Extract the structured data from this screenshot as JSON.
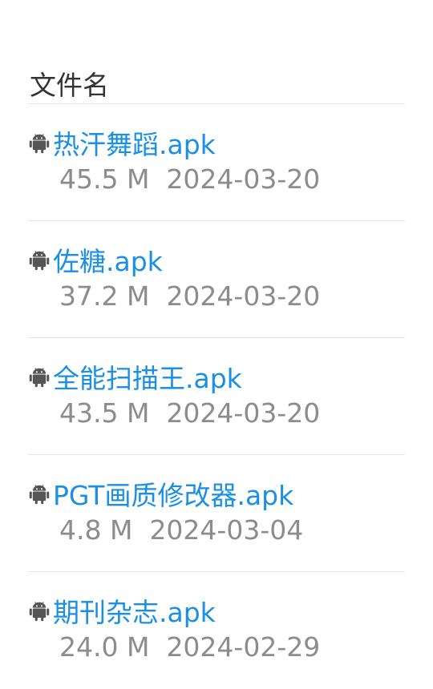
{
  "header": {
    "column_label": "文件名"
  },
  "colors": {
    "link": "#1a8fe3",
    "meta": "#8c8c8c",
    "header": "#333333",
    "divider": "#e6e6e6"
  },
  "files": [
    {
      "icon": "android-icon",
      "name": "热汗舞蹈.apk",
      "size": "45.5 M",
      "date": "2024-03-20"
    },
    {
      "icon": "android-icon",
      "name": "佐糖.apk",
      "size": "37.2 M",
      "date": "2024-03-20"
    },
    {
      "icon": "android-icon",
      "name": "全能扫描王.apk",
      "size": "43.5 M",
      "date": "2024-03-20"
    },
    {
      "icon": "android-icon",
      "name": "PGT画质修改器.apk",
      "size": "4.8 M",
      "date": "2024-03-04"
    },
    {
      "icon": "android-icon",
      "name": "期刊杂志.apk",
      "size": "24.0 M",
      "date": "2024-02-29"
    }
  ]
}
